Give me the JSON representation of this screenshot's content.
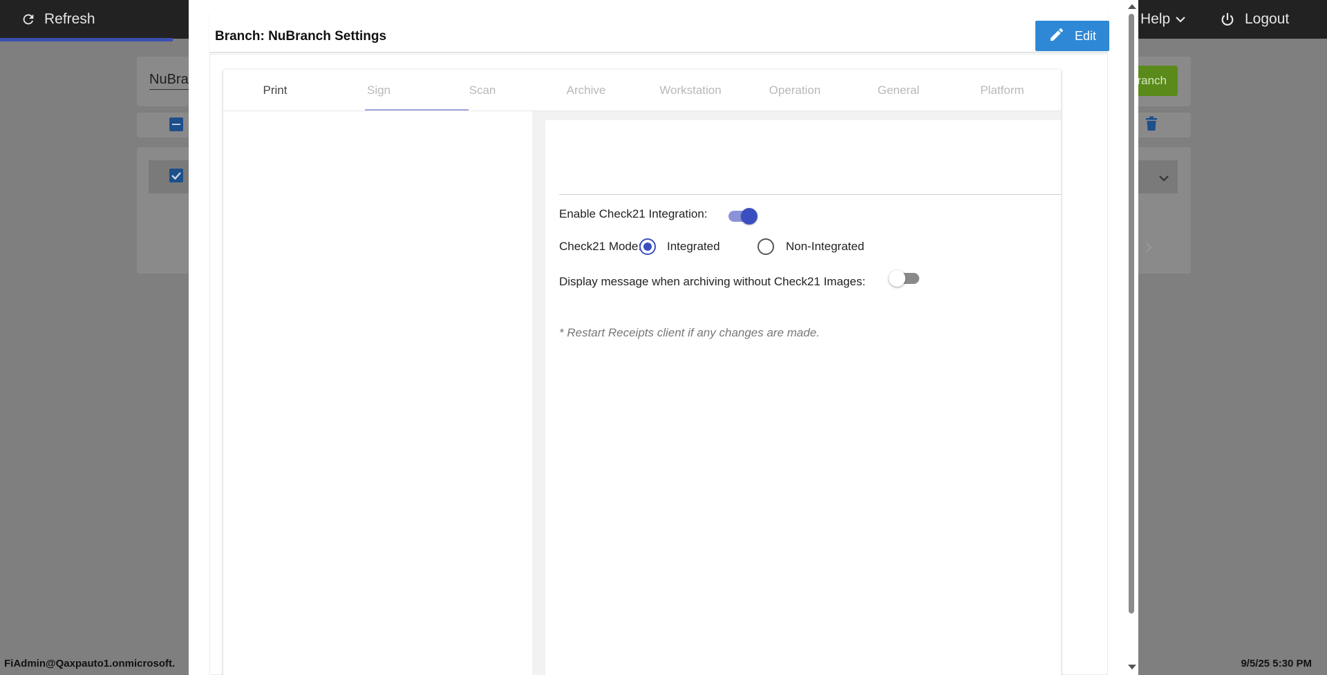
{
  "topbar": {
    "refresh_label": "Refresh",
    "help_label": "Help",
    "logout_label": "Logout"
  },
  "background": {
    "search_value": "NuBranch",
    "action_label": "Branch"
  },
  "status": {
    "user": "FiAdmin@Qaxpauto1.onmicrosoft.",
    "datetime": "9/5/25 5:30 PM"
  },
  "modal": {
    "title": "Branch: NuBranch Settings",
    "edit_label": "Edit",
    "tabs": [
      {
        "label": "Print"
      },
      {
        "label": "Sign"
      },
      {
        "label": "Scan"
      },
      {
        "label": "Archive"
      },
      {
        "label": "Workstation"
      },
      {
        "label": "Operation"
      },
      {
        "label": "General"
      },
      {
        "label": "Platform"
      }
    ],
    "active_tab": "Sign",
    "settings": {
      "enable_check21_label": "Enable Check21 Integration:",
      "enable_check21_on": true,
      "mode_label": "Check21 Mode:",
      "mode_options": [
        "Integrated",
        "Non-Integrated"
      ],
      "mode_selected": "Integrated",
      "display_message_label": "Display message when archiving without Check21 Images:",
      "display_message_on": false,
      "note": "* Restart Receipts client if any changes are made."
    }
  },
  "colors": {
    "accent": "#3a4fbf",
    "edit_button": "#2e88d6",
    "topbar": "#222222"
  }
}
